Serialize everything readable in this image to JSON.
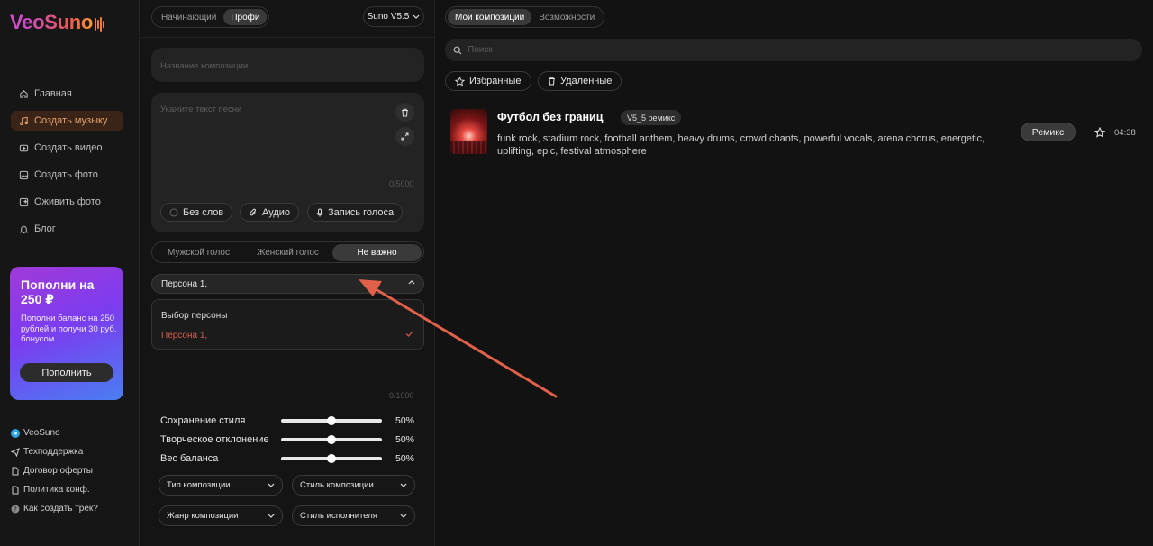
{
  "brand": {
    "logo_v": "V",
    "logo_rest": "eoSuno"
  },
  "sidebar": {
    "nav": [
      {
        "label": "Главная",
        "icon": "home-icon",
        "active": false
      },
      {
        "label": "Создать музыку",
        "icon": "music-note-icon",
        "active": true
      },
      {
        "label": "Создать видео",
        "icon": "video-icon",
        "active": false
      },
      {
        "label": "Создать фото",
        "icon": "image-icon",
        "active": false
      },
      {
        "label": "Оживить фото",
        "icon": "animate-photo-icon",
        "active": false
      },
      {
        "label": "Блог",
        "icon": "bell-icon",
        "active": false
      }
    ],
    "promo": {
      "title_line1": "Пополни на",
      "title_line2": "250 ₽",
      "text": "Пополни баланс на 250 рублей и получи 30 руб. бонусом",
      "button": "Пополнить"
    },
    "footer": [
      {
        "label": "VeoSuno",
        "icon": "telegram-icon"
      },
      {
        "label": "Техподдержка",
        "icon": "send-icon"
      },
      {
        "label": "Договор оферты",
        "icon": "document-icon"
      },
      {
        "label": "Политика конф.",
        "icon": "document-icon"
      },
      {
        "label": "Как создать трек?",
        "icon": "help-icon"
      }
    ]
  },
  "create": {
    "mode_tabs": [
      "Начинающий",
      "Профи"
    ],
    "active_mode": "Профи",
    "model": "Suno V5.5",
    "title_placeholder": "Название композиции",
    "lyrics_placeholder": "Укажите текст песни",
    "lyrics_counter": "0/5000",
    "options": [
      "Без слов",
      "Аудио",
      "Запись голоса"
    ],
    "voice_tabs": [
      "Мужской голос",
      "Женский голос",
      "Не важно"
    ],
    "active_voice": "Не важно",
    "persona_value": "Персона 1,",
    "persona_dropdown": {
      "header": "Выбор персоны",
      "option": "Персона 1,"
    },
    "style_counter": "0/1000",
    "sliders": [
      {
        "label": "Сохранение стиля",
        "value": "50%",
        "level": 0.5
      },
      {
        "label": "Творческое отклонение",
        "value": "50%",
        "level": 0.5
      },
      {
        "label": "Вес баланса",
        "value": "50%",
        "level": 0.5
      }
    ],
    "selects": [
      "Тип композиции",
      "Стиль композиции",
      "Жанр композиции",
      "Стиль исполнителя"
    ]
  },
  "library": {
    "tabs": [
      "Мои композиции",
      "Возможности"
    ],
    "active_tab": "Мои композиции",
    "search_placeholder": "Поиск",
    "filters": [
      "Избранные",
      "Удаленные"
    ],
    "tracks": [
      {
        "title": "Футбол без границ",
        "badge": "V5_5 ремикс",
        "description": "funk rock, stadium rock, football anthem, heavy drums, crowd chants, powerful vocals, arena chorus, energetic, uplifting, epic, festival atmosphere",
        "remix_label": "Ремикс",
        "duration": "04:38"
      }
    ]
  },
  "colors": {
    "accent": "#e8a36d",
    "active_bg": "#3a2418",
    "selected_option": "#d9604a",
    "annotation_arrow": "#e0604a"
  }
}
